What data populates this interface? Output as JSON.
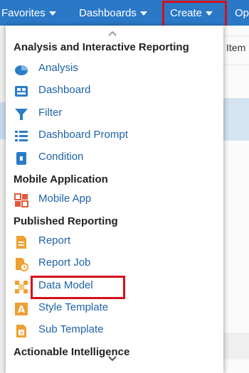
{
  "nav": {
    "favorites": "Favorites",
    "dashboards": "Dashboards",
    "create": "Create",
    "open_partial": "Op"
  },
  "background": {
    "column_header_partial": "Item"
  },
  "menu": {
    "sections": {
      "analysis": "Analysis and Interactive Reporting",
      "mobile": "Mobile Application",
      "published": "Published Reporting",
      "actionable": "Actionable Intelligence"
    },
    "items": {
      "analysis": {
        "label": "Analysis",
        "icon": "analysis-icon"
      },
      "dashboard": {
        "label": "Dashboard",
        "icon": "dashboard-icon"
      },
      "filter": {
        "label": "Filter",
        "icon": "filter-icon"
      },
      "dashboard_prompt": {
        "label": "Dashboard Prompt",
        "icon": "dashboard-prompt-icon"
      },
      "condition": {
        "label": "Condition",
        "icon": "condition-icon"
      },
      "mobile_app": {
        "label": "Mobile App",
        "icon": "mobile-app-icon"
      },
      "report": {
        "label": "Report",
        "icon": "report-icon"
      },
      "report_job": {
        "label": "Report Job",
        "icon": "report-job-icon"
      },
      "data_model": {
        "label": "Data Model",
        "icon": "data-model-icon"
      },
      "style_template": {
        "label": "Style Template",
        "icon": "style-template-icon"
      },
      "sub_template": {
        "label": "Sub Template",
        "icon": "sub-template-icon"
      }
    }
  },
  "colors": {
    "nav_bar": "#2a78c6",
    "link_text": "#1d63a8",
    "highlight_box": "#d4111b",
    "icon_blue": "#2a7cc7",
    "icon_orange": "#f0a030",
    "icon_red": "#e05a3c"
  }
}
